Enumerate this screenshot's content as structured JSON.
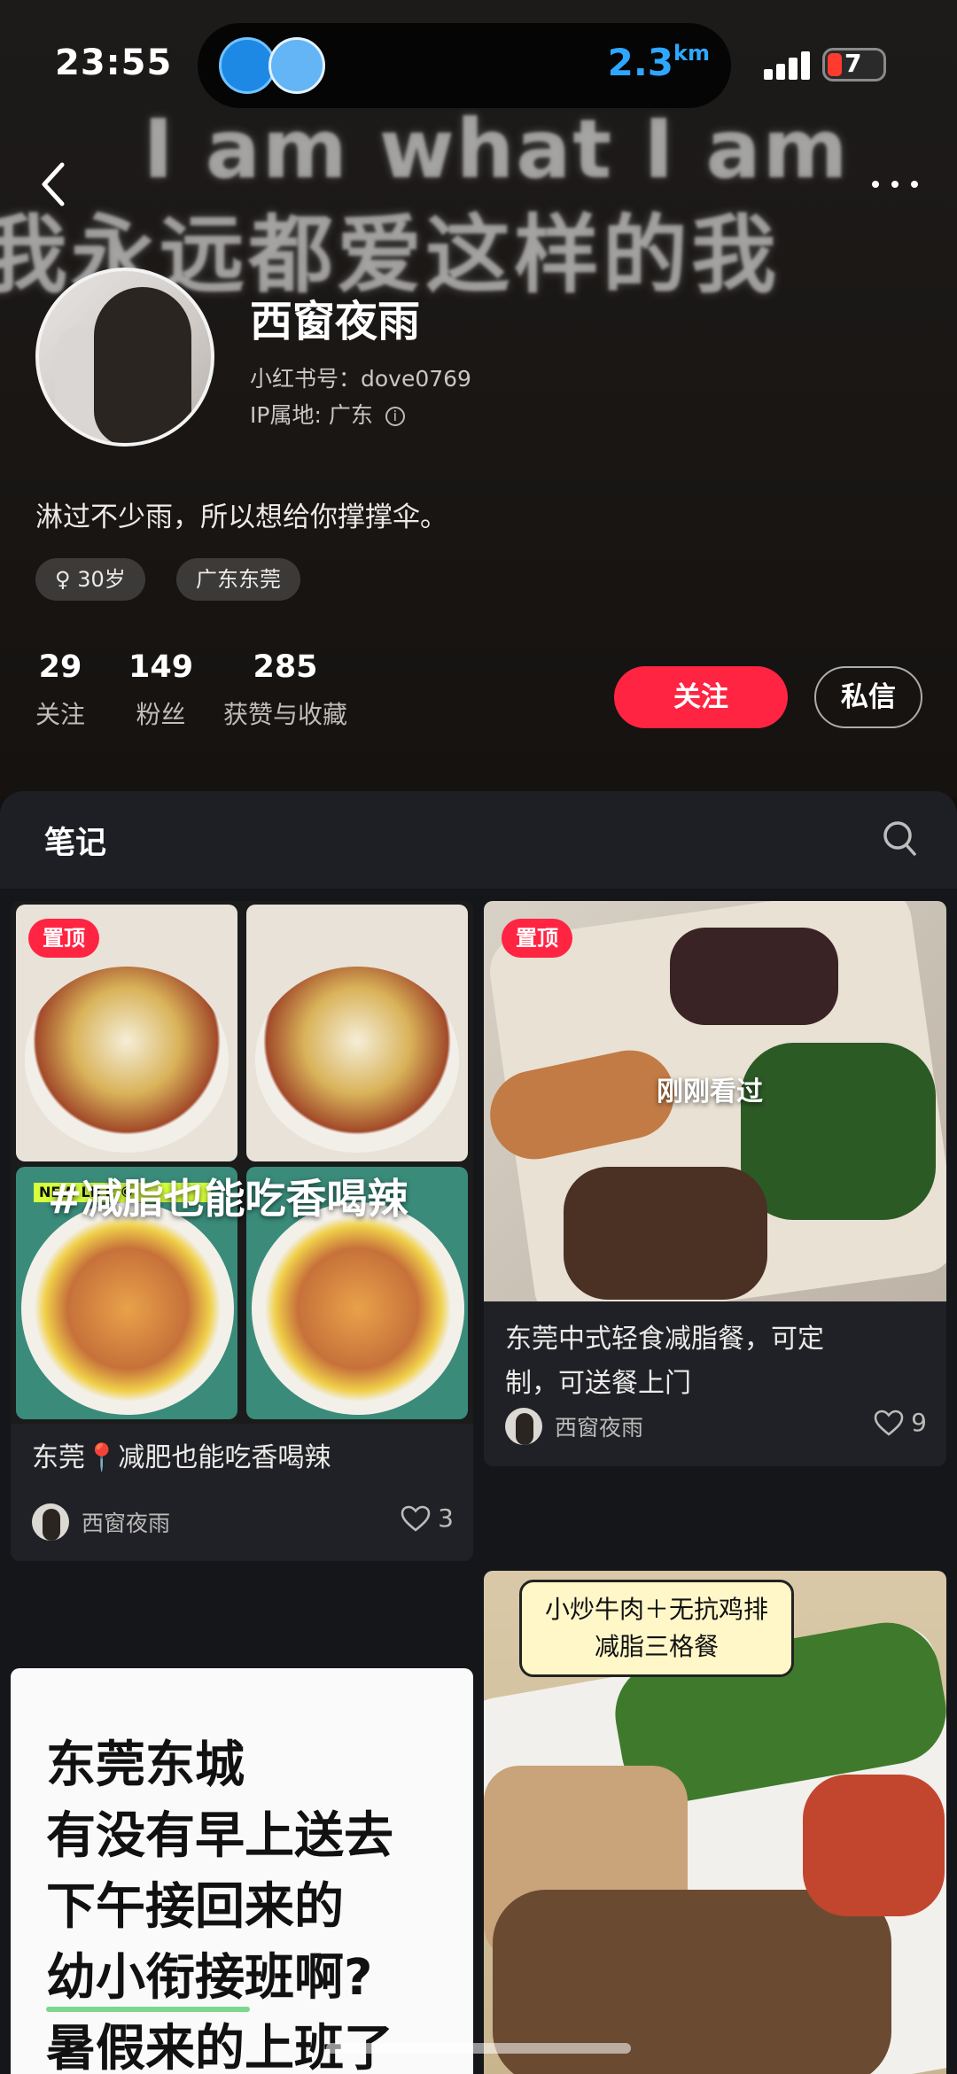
{
  "status_bar": {
    "time": "23:55",
    "speed_value": "2.3",
    "speed_unit": "km",
    "battery": "7"
  },
  "banner": {
    "line1": "I am what I am",
    "line2": "我永远都爱这样的我"
  },
  "profile": {
    "name": "西窗夜雨",
    "red_id": "小红书号：dove0769",
    "ip_location": "IP属地: 广东",
    "bio": "淋过不少雨，所以想给你撑撑伞。",
    "tag_age": "♀ 30岁",
    "tag_location": "广东东莞",
    "stats": [
      {
        "value": "29",
        "label": "关注"
      },
      {
        "value": "149",
        "label": "粉丝"
      },
      {
        "value": "285",
        "label": "获赞与收藏"
      }
    ],
    "follow_button": "关注",
    "message_button": "私信"
  },
  "tabs": {
    "notes": "笔记"
  },
  "notes": [
    {
      "pinned_label": "置顶",
      "overlay_text": "#减脂也能吃香喝辣",
      "sticker_text": "NEW LIFE ©",
      "title": "东莞📍减肥也能吃香喝辣",
      "author": "西窗夜雨",
      "likes": "3"
    },
    {
      "pinned_label": "置顶",
      "overlay_text": "刚刚看过",
      "title_line1": "东莞中式轻食减脂餐，可定",
      "title_line2": "制，可送餐上门",
      "author": "西窗夜雨",
      "likes": "9"
    },
    {
      "text_lines": [
        "东莞东城",
        "有没有早上送去",
        "下午接回来的",
        "幼小衔接班啊?",
        "暑假来的上班了"
      ]
    },
    {
      "bubble_line1": "小炒牛肉＋无抗鸡排",
      "bubble_line2": "减脂三格餐"
    }
  ],
  "colors": {
    "accent": "#ff2442",
    "background": "#120f0e",
    "speed": "#2ea7ff"
  }
}
